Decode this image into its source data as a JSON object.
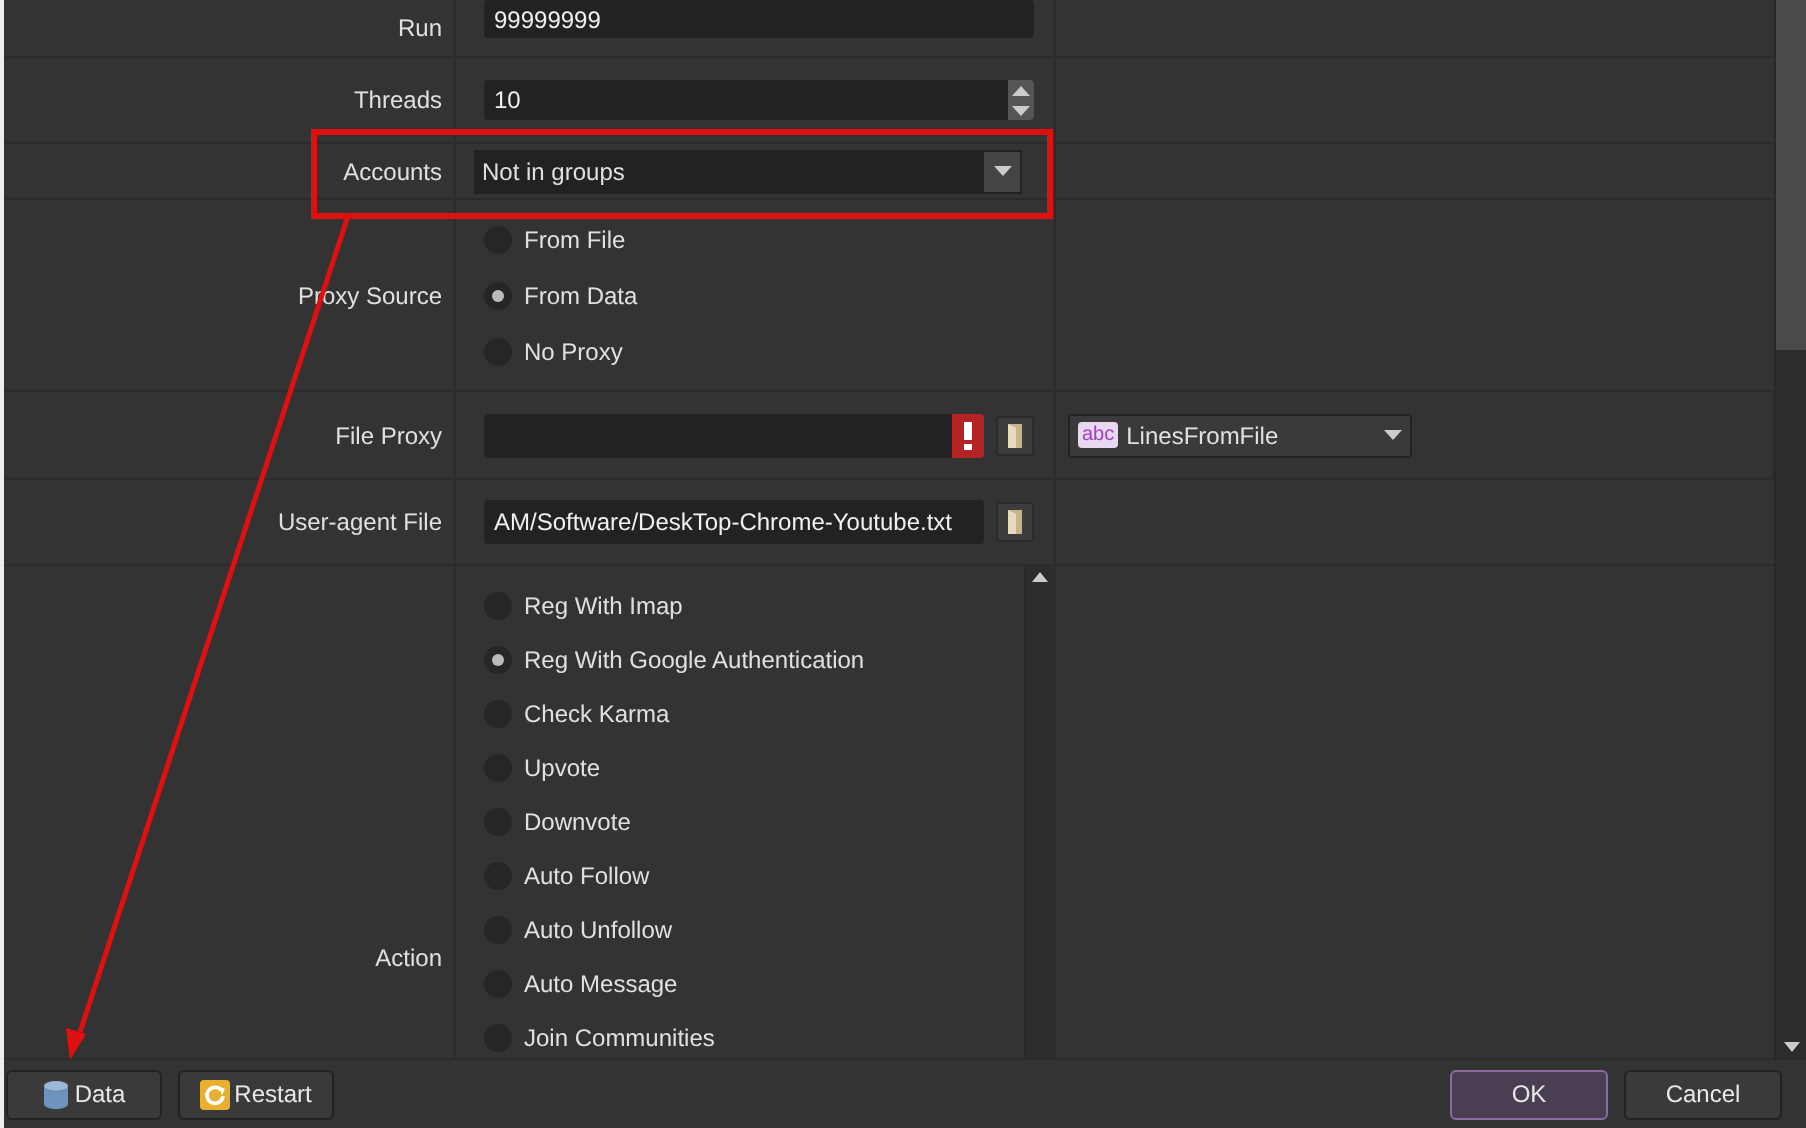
{
  "form": {
    "rows": [
      {
        "kind": "text",
        "label": "Run",
        "value": "99999999"
      },
      {
        "kind": "spin",
        "label": "Threads",
        "value": "10"
      },
      {
        "kind": "combo",
        "label": "Accounts",
        "value": "Not in groups"
      },
      {
        "kind": "radio",
        "label": "Proxy Source",
        "options": [
          {
            "label": "From File",
            "selected": false
          },
          {
            "label": "From Data",
            "selected": true
          },
          {
            "label": "No Proxy",
            "selected": false
          }
        ]
      },
      {
        "kind": "file",
        "label": "File Proxy",
        "error": true,
        "source": {
          "badge": "abc",
          "value": "LinesFromFile"
        }
      },
      {
        "kind": "file",
        "label": "User-agent File",
        "value": "AM/Software/DeskTop-Chrome-Youtube.txt"
      },
      {
        "kind": "radiolist",
        "label": "Action",
        "options": [
          {
            "label": "Reg With Imap",
            "selected": false
          },
          {
            "label": "Reg With Google Authentication",
            "selected": true
          },
          {
            "label": "Check Karma",
            "selected": false
          },
          {
            "label": "Upvote",
            "selected": false
          },
          {
            "label": "Downvote",
            "selected": false
          },
          {
            "label": "Auto Follow",
            "selected": false
          },
          {
            "label": "Auto Unfollow",
            "selected": false
          },
          {
            "label": "Auto Message",
            "selected": false
          },
          {
            "label": "Join Communities",
            "selected": false
          }
        ]
      }
    ]
  },
  "buttons_left": [
    {
      "kind": "data",
      "label": "Data"
    },
    {
      "kind": "restart",
      "label": "Restart"
    }
  ],
  "buttons_right": [
    {
      "label": "OK",
      "default": true
    },
    {
      "label": "Cancel",
      "default": false
    }
  ]
}
